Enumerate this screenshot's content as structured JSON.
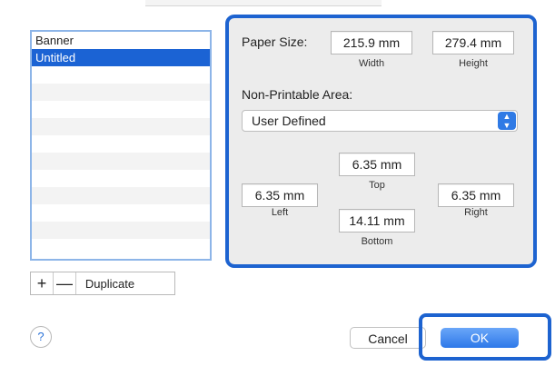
{
  "list": {
    "items": [
      "Banner",
      "Untitled"
    ],
    "selected_index": 1,
    "empty_rows": 11
  },
  "list_controls": {
    "add_label": "+",
    "remove_label": "—",
    "duplicate_label": "Duplicate"
  },
  "paper_size": {
    "label": "Paper Size:",
    "width_value": "215.9 mm",
    "width_caption": "Width",
    "height_value": "279.4 mm",
    "height_caption": "Height"
  },
  "non_printable": {
    "label": "Non-Printable Area:",
    "select_value": "User Defined",
    "top_value": "6.35 mm",
    "top_caption": "Top",
    "left_value": "6.35 mm",
    "left_caption": "Left",
    "right_value": "6.35 mm",
    "right_caption": "Right",
    "bottom_value": "14.11 mm",
    "bottom_caption": "Bottom"
  },
  "footer": {
    "help_label": "?",
    "cancel_label": "Cancel",
    "ok_label": "OK"
  },
  "colors": {
    "accent": "#1d63d0",
    "selection": "#1b63d4"
  }
}
